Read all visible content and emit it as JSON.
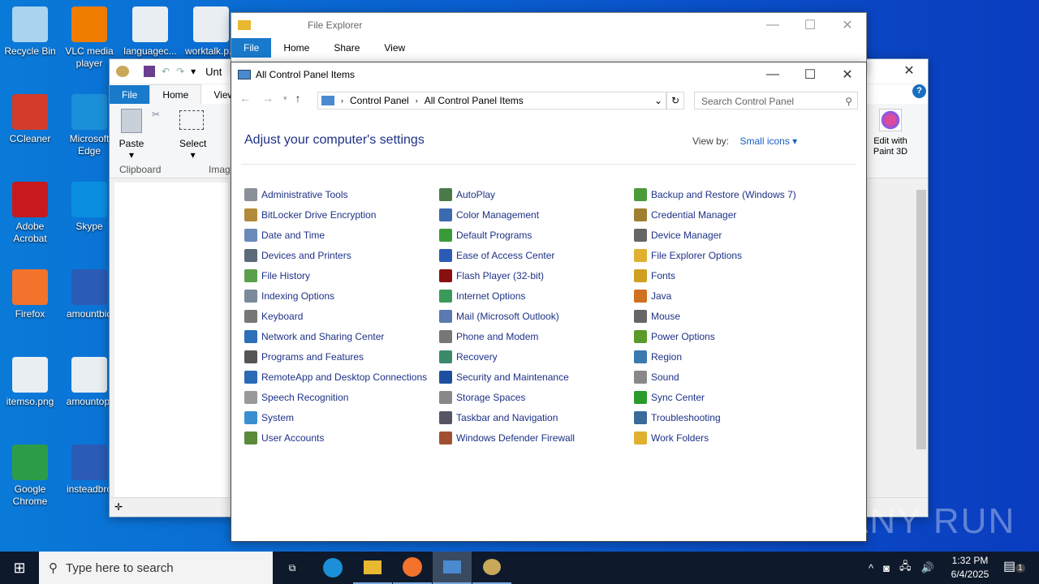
{
  "desktop": {
    "icons": [
      {
        "label": "Recycle Bin",
        "color": "#a8d4f0"
      },
      {
        "label": "VLC media player",
        "color": "#f07c00"
      },
      {
        "label": "languagec...",
        "color": "#e8eef2"
      },
      {
        "label": "worktalk.p...",
        "color": "#e8eef2"
      },
      {
        "label": "CCleaner",
        "color": "#d43b2b"
      },
      {
        "label": "Microsoft Edge",
        "color": "#1b8fd8"
      },
      {
        "label": "Adobe Acrobat",
        "color": "#c8191c"
      },
      {
        "label": "Skype",
        "color": "#0a8fe0"
      },
      {
        "label": "Firefox",
        "color": "#f3722c"
      },
      {
        "label": "amountbid",
        "color": "#2b5bb5"
      },
      {
        "label": "itemso.png",
        "color": "#e8eef2"
      },
      {
        "label": "amountopt",
        "color": "#e8eef2"
      },
      {
        "label": "Google Chrome",
        "color": "#2d9c48"
      },
      {
        "label": "insteadbro",
        "color": "#2b5bb5"
      }
    ]
  },
  "paint": {
    "title": "Unt",
    "tabs": [
      "File",
      "Home",
      "View"
    ],
    "paste": "Paste",
    "select": "Select",
    "clipboard": "Clipboard",
    "image": "Image",
    "edit3d": "Edit with Paint 3D"
  },
  "explorer": {
    "title": "File Explorer",
    "tabs": [
      "File",
      "Home",
      "Share",
      "View"
    ]
  },
  "control_panel": {
    "title": "All Control Panel Items",
    "breadcrumb": [
      "Control Panel",
      "All Control Panel Items"
    ],
    "search_placeholder": "Search Control Panel",
    "heading": "Adjust your computer's settings",
    "view_by_label": "View by:",
    "view_by_value": "Small icons",
    "columns": [
      [
        {
          "label": "Administrative Tools",
          "color": "#8a8f99"
        },
        {
          "label": "BitLocker Drive Encryption",
          "color": "#b38a3a"
        },
        {
          "label": "Date and Time",
          "color": "#6a8ab8"
        },
        {
          "label": "Devices and Printers",
          "color": "#5b6b7a"
        },
        {
          "label": "File History",
          "color": "#5aa04a"
        },
        {
          "label": "Indexing Options",
          "color": "#7a8a9a"
        },
        {
          "label": "Keyboard",
          "color": "#777"
        },
        {
          "label": "Network and Sharing Center",
          "color": "#2d6fb8"
        },
        {
          "label": "Programs and Features",
          "color": "#555"
        },
        {
          "label": "RemoteApp and Desktop Connections",
          "color": "#2b6ab5"
        },
        {
          "label": "Speech Recognition",
          "color": "#999"
        },
        {
          "label": "System",
          "color": "#3a8fd0"
        },
        {
          "label": "User Accounts",
          "color": "#5a8a3a"
        }
      ],
      [
        {
          "label": "AutoPlay",
          "color": "#4a7a4a"
        },
        {
          "label": "Color Management",
          "color": "#3a6ab0"
        },
        {
          "label": "Default Programs",
          "color": "#3a9a3a"
        },
        {
          "label": "Ease of Access Center",
          "color": "#2b5bb5"
        },
        {
          "label": "Flash Player (32-bit)",
          "color": "#8a1010"
        },
        {
          "label": "Internet Options",
          "color": "#3a9a5a"
        },
        {
          "label": "Mail (Microsoft Outlook)",
          "color": "#5a7ab0"
        },
        {
          "label": "Phone and Modem",
          "color": "#777"
        },
        {
          "label": "Recovery",
          "color": "#3a8a6a"
        },
        {
          "label": "Security and Maintenance",
          "color": "#1d4fa0"
        },
        {
          "label": "Storage Spaces",
          "color": "#888"
        },
        {
          "label": "Taskbar and Navigation",
          "color": "#556"
        },
        {
          "label": "Windows Defender Firewall",
          "color": "#a05030"
        }
      ],
      [
        {
          "label": "Backup and Restore (Windows 7)",
          "color": "#4a9a3a"
        },
        {
          "label": "Credential Manager",
          "color": "#a08030"
        },
        {
          "label": "Device Manager",
          "color": "#666"
        },
        {
          "label": "File Explorer Options",
          "color": "#e0b030"
        },
        {
          "label": "Fonts",
          "color": "#d0a020"
        },
        {
          "label": "Java",
          "color": "#d07020"
        },
        {
          "label": "Mouse",
          "color": "#666"
        },
        {
          "label": "Power Options",
          "color": "#5a9a2a"
        },
        {
          "label": "Region",
          "color": "#3a7ab0"
        },
        {
          "label": "Sound",
          "color": "#888"
        },
        {
          "label": "Sync Center",
          "color": "#2a9a2a"
        },
        {
          "label": "Troubleshooting",
          "color": "#3a6a9a"
        },
        {
          "label": "Work Folders",
          "color": "#e0b030"
        }
      ]
    ]
  },
  "taskbar": {
    "search_placeholder": "Type here to search",
    "time": "1:32 PM",
    "date": "6/4/2025",
    "notifications": "1"
  },
  "watermark": "ANY RUN"
}
